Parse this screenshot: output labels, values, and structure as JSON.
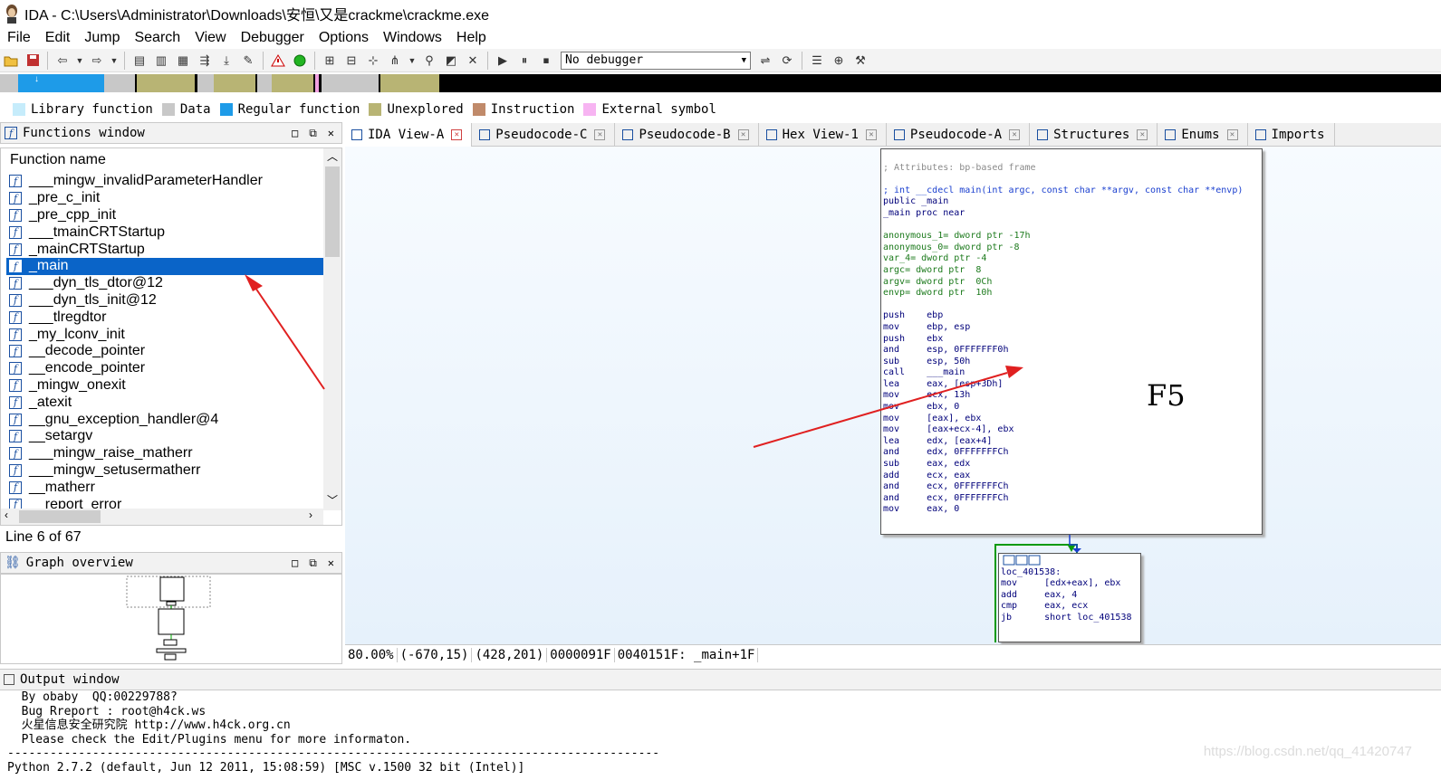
{
  "window": {
    "title": "IDA - C:\\Users\\Administrator\\Downloads\\安恒\\又是crackme\\crackme.exe"
  },
  "menu": [
    {
      "label": "File"
    },
    {
      "label": "Edit"
    },
    {
      "label": "Jump"
    },
    {
      "label": "Search"
    },
    {
      "label": "View"
    },
    {
      "label": "Debugger"
    },
    {
      "label": "Options"
    },
    {
      "label": "Windows"
    },
    {
      "label": "Help"
    }
  ],
  "toolbar": {
    "debugger_select": "No debugger"
  },
  "legend": [
    {
      "label": "Library function",
      "color": "#c6ecfb"
    },
    {
      "label": "Data",
      "color": "#c8c8c8"
    },
    {
      "label": "Regular function",
      "color": "#1e9be8"
    },
    {
      "label": "Unexplored",
      "color": "#b8b474"
    },
    {
      "label": "Instruction",
      "color": "#c08a6a"
    },
    {
      "label": "External symbol",
      "color": "#f7b4f2"
    }
  ],
  "functions_panel": {
    "title": "Functions window",
    "column_header": "Function name",
    "items": [
      "___mingw_invalidParameterHandler",
      "_pre_c_init",
      "_pre_cpp_init",
      "___tmainCRTStartup",
      "_mainCRTStartup",
      "_main",
      "___dyn_tls_dtor@12",
      "___dyn_tls_init@12",
      "___tlregdtor",
      "_my_lconv_init",
      "__decode_pointer",
      "__encode_pointer",
      "_mingw_onexit",
      "_atexit",
      "__gnu_exception_handler@4",
      "__setargv",
      "___mingw_raise_matherr",
      "___mingw_setusermatherr",
      "__matherr",
      "__report_error"
    ],
    "selected_index": 5,
    "line_info": "Line 6 of 67"
  },
  "graph_overview": {
    "title": "Graph overview"
  },
  "tabs": [
    {
      "label": "IDA View-A",
      "active": true
    },
    {
      "label": "Pseudocode-C"
    },
    {
      "label": "Pseudocode-B"
    },
    {
      "label": "Hex View-1"
    },
    {
      "label": "Pseudocode-A"
    },
    {
      "label": "Structures"
    },
    {
      "label": "Enums"
    },
    {
      "label": "Imports"
    }
  ],
  "disasm_main": [
    {
      "text": "",
      "cls": ""
    },
    {
      "text": "; Attributes: bp-based frame",
      "cls": "c-gray"
    },
    {
      "text": "",
      "cls": ""
    },
    {
      "text": "; int __cdecl main(int argc, const char **argv, const char **envp)",
      "cls": "c-blue"
    },
    {
      "text": "public _main",
      "cls": "c-navy"
    },
    {
      "text": "_main proc near",
      "cls": "c-navy"
    },
    {
      "text": "",
      "cls": ""
    },
    {
      "text": "anonymous_1= dword ptr -17h",
      "cls": "c-green"
    },
    {
      "text": "anonymous_0= dword ptr -8",
      "cls": "c-green"
    },
    {
      "text": "var_4= dword ptr -4",
      "cls": "c-green"
    },
    {
      "text": "argc= dword ptr  8",
      "cls": "c-green"
    },
    {
      "text": "argv= dword ptr  0Ch",
      "cls": "c-green"
    },
    {
      "text": "envp= dword ptr  10h",
      "cls": "c-green"
    },
    {
      "text": "",
      "cls": ""
    },
    {
      "text": "push    ebp",
      "cls": "c-navy"
    },
    {
      "text": "mov     ebp, esp",
      "cls": "c-navy"
    },
    {
      "text": "push    ebx",
      "cls": "c-navy"
    },
    {
      "text": "and     esp, 0FFFFFFF0h",
      "cls": "c-navy"
    },
    {
      "text": "sub     esp, 50h",
      "cls": "c-navy"
    },
    {
      "text": "call    ___main",
      "cls": "c-navy"
    },
    {
      "text": "lea     eax, [esp+3Dh]",
      "cls": "c-navy"
    },
    {
      "text": "mov     ecx, 13h",
      "cls": "c-navy"
    },
    {
      "text": "mov     ebx, 0",
      "cls": "c-navy"
    },
    {
      "text": "mov     [eax], ebx",
      "cls": "c-navy"
    },
    {
      "text": "mov     [eax+ecx-4], ebx",
      "cls": "c-navy"
    },
    {
      "text": "lea     edx, [eax+4]",
      "cls": "c-navy"
    },
    {
      "text": "and     edx, 0FFFFFFFCh",
      "cls": "c-navy"
    },
    {
      "text": "sub     eax, edx",
      "cls": "c-navy"
    },
    {
      "text": "add     ecx, eax",
      "cls": "c-navy"
    },
    {
      "text": "and     ecx, 0FFFFFFFCh",
      "cls": "c-navy"
    },
    {
      "text": "and     ecx, 0FFFFFFFCh",
      "cls": "c-navy"
    },
    {
      "text": "mov     eax, 0",
      "cls": "c-navy"
    }
  ],
  "disasm_loop": [
    {
      "text": "",
      "cls": ""
    },
    {
      "text": "loc_401538:",
      "cls": "c-navy"
    },
    {
      "text": "mov     [edx+eax], ebx",
      "cls": "c-navy"
    },
    {
      "text": "add     eax, 4",
      "cls": "c-navy"
    },
    {
      "text": "cmp     eax, ecx",
      "cls": "c-navy"
    },
    {
      "text": "jb      short loc_401538",
      "cls": "c-navy"
    }
  ],
  "annotation": "F5",
  "status": {
    "zoom": "80.00%",
    "coords1": "(-670,15)",
    "coords2": "(428,201)",
    "offset": "0000091F",
    "address": "0040151F: _main+1F"
  },
  "output_panel": {
    "title": "Output window",
    "lines": [
      "  By obaby  QQ:00229788?",
      "  Bug Rreport : root@h4ck.ws",
      "  火星信息安全研究院 http://www.h4ck.org.cn",
      "  Please check the Edit/Plugins menu for more informaton.",
      "--------------------------------------------------------------------------------------------",
      "Python 2.7.2 (default, Jun 12 2011, 15:08:59) [MSC v.1500 32 bit (Intel)]"
    ]
  },
  "watermark": "https://blog.csdn.net/qq_41420747"
}
